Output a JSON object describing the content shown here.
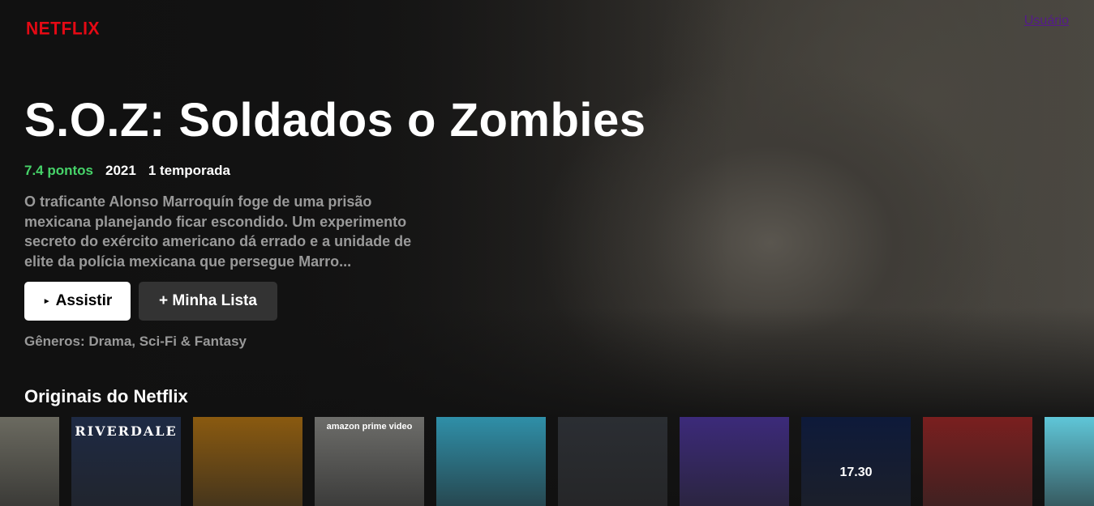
{
  "header": {
    "logo": "NETFLIX",
    "user_link": "Usuário"
  },
  "featured": {
    "title": "S.O.Z: Soldados o Zombies",
    "points": "7.4 pontos",
    "year": "2021",
    "seasons": "1 temporada",
    "description": "O traficante Alonso Marroquín foge de uma prisão mexicana planejando ficar escondido. Um experimento secreto do exército americano dá errado e a unidade de elite da polícia mexicana que persegue Marro...",
    "play_icon": "►",
    "play_label": "Assistir",
    "list_label": "+ Minha Lista",
    "genres": "Gêneros: Drama, Sci-Fi & Fantasy"
  },
  "row": {
    "title": "Originais do Netflix",
    "posters": [
      {
        "label": "",
        "sub": "",
        "color": "#6b6a60"
      },
      {
        "label": "RIVERDALE",
        "sub": "",
        "color": "#1e2a44"
      },
      {
        "label": "",
        "sub": "",
        "color": "#8a5a10"
      },
      {
        "label": "",
        "sub": "amazon prime video",
        "color": "#6d6d6a"
      },
      {
        "label": "",
        "sub": "",
        "color": "#2f8fa8"
      },
      {
        "label": "",
        "sub": "",
        "color": "#2b2e33"
      },
      {
        "label": "",
        "sub": "",
        "color": "#3c2a7a"
      },
      {
        "label": "",
        "sub": "17.30",
        "color": "#0e1a3a"
      },
      {
        "label": "",
        "sub": "",
        "color": "#7a1f1f"
      },
      {
        "label": "",
        "sub": "",
        "color": "#5fc6d8"
      }
    ]
  }
}
